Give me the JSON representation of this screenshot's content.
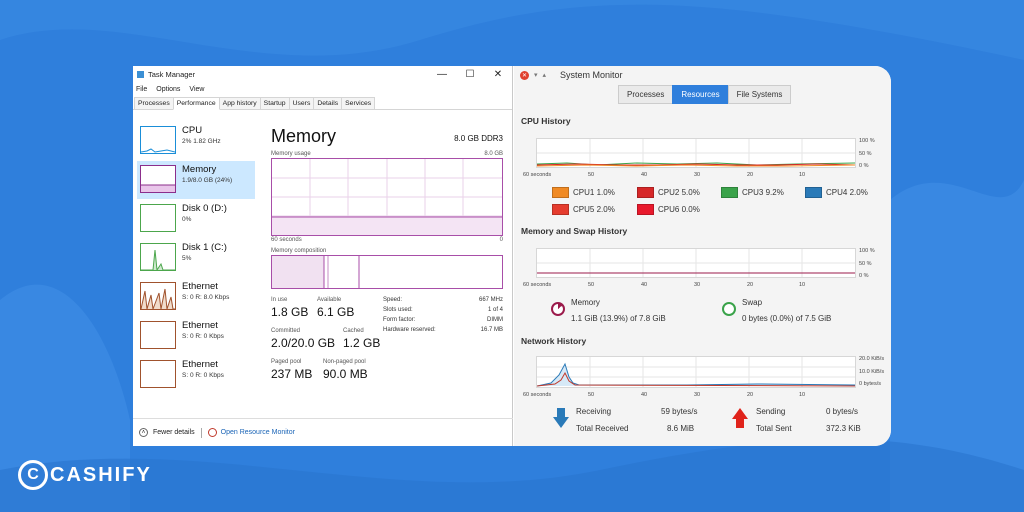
{
  "brand": {
    "mark": "C",
    "text": "CASHIFY"
  },
  "task_manager": {
    "title": "Task Manager",
    "window_controls": [
      "—",
      "☐",
      "✕"
    ],
    "menu": [
      "File",
      "Options",
      "View"
    ],
    "tabs": [
      "Processes",
      "Performance",
      "App history",
      "Startup",
      "Users",
      "Details",
      "Services"
    ],
    "active_tab": "Performance",
    "sidebar": [
      {
        "name": "CPU",
        "sub": "2% 1.82 GHz",
        "color": "#1a8ed8"
      },
      {
        "name": "Memory",
        "sub": "1.9/8.0 GB (24%)",
        "color": "#8b2e8b"
      },
      {
        "name": "Disk 0 (D:)",
        "sub": "0%",
        "color": "#4ca64c"
      },
      {
        "name": "Disk 1 (C:)",
        "sub": "5%",
        "color": "#4ca64c"
      },
      {
        "name": "Ethernet",
        "sub": "S: 0 R: 8.0 Kbps",
        "color": "#a0522d"
      },
      {
        "name": "Ethernet",
        "sub": "S: 0 R: 0 Kbps",
        "color": "#a0522d"
      },
      {
        "name": "Ethernet",
        "sub": "S: 0 R: 0 Kbps",
        "color": "#a0522d"
      }
    ],
    "heading": "Memory",
    "spec": "8.0 GB DDR3",
    "usage_label": "Memory usage",
    "usage_max": "8.0 GB",
    "x_left": "60 seconds",
    "x_right": "0",
    "composition_label": "Memory composition",
    "stats": {
      "in_use_label": "In use",
      "in_use": "1.8 GB",
      "available_label": "Available",
      "available": "6.1 GB",
      "committed_label": "Committed",
      "committed": "2.0/20.0 GB",
      "cached_label": "Cached",
      "cached": "1.2 GB",
      "paged_label": "Paged pool",
      "paged": "237 MB",
      "nonpaged_label": "Non-paged pool",
      "nonpaged": "90.0 MB"
    },
    "details": [
      {
        "k": "Speed:",
        "v": "667 MHz"
      },
      {
        "k": "Slots used:",
        "v": "1 of 4"
      },
      {
        "k": "Form factor:",
        "v": "DIMM"
      },
      {
        "k": "Hardware reserved:",
        "v": "16.7 MB"
      }
    ],
    "footer": {
      "fewer": "Fewer details",
      "open_rm": "Open Resource Monitor"
    }
  },
  "system_monitor": {
    "title": "System Monitor",
    "tabs": [
      "Processes",
      "Resources",
      "File Systems"
    ],
    "active_tab": "Resources",
    "cpu": {
      "title": "CPU History",
      "x_ticks": [
        "60 seconds",
        "50",
        "40",
        "30",
        "20",
        "10"
      ],
      "y_ticks": [
        "100 %",
        "50 %",
        "0 %"
      ],
      "legend": [
        {
          "label": "CPU1",
          "value": "1.0%",
          "color": "#f08a24"
        },
        {
          "label": "CPU2",
          "value": "5.0%",
          "color": "#d62728"
        },
        {
          "label": "CPU3",
          "value": "9.2%",
          "color": "#3aa34a"
        },
        {
          "label": "CPU4",
          "value": "2.0%",
          "color": "#2a7ab8"
        },
        {
          "label": "CPU5",
          "value": "2.0%",
          "color": "#e53c2e"
        },
        {
          "label": "CPU6",
          "value": "0.0%",
          "color": "#e8192c"
        }
      ]
    },
    "memswap": {
      "title": "Memory and Swap History",
      "x_ticks": [
        "60 seconds",
        "50",
        "40",
        "30",
        "20",
        "10"
      ],
      "y_ticks": [
        "100 %",
        "50 %",
        "0 %"
      ],
      "memory_label": "Memory",
      "memory_value": "1.1 GiB (13.9%) of 7.8 GiB",
      "memory_fraction": 0.139,
      "swap_label": "Swap",
      "swap_value": "0 bytes (0.0%) of 7.5 GiB",
      "swap_fraction": 0.0
    },
    "network": {
      "title": "Network History",
      "x_ticks": [
        "60 seconds",
        "50",
        "40",
        "30",
        "20",
        "10"
      ],
      "y_ticks": [
        "20.0 KiB/s",
        "10.0 KiB/s",
        "0 bytes/s"
      ],
      "receiving_label": "Receiving",
      "receiving": "59 bytes/s",
      "total_received_label": "Total Received",
      "total_received": "8.6 MiB",
      "sending_label": "Sending",
      "sending": "0 bytes/s",
      "total_sent_label": "Total Sent",
      "total_sent": "372.3 KiB"
    }
  }
}
